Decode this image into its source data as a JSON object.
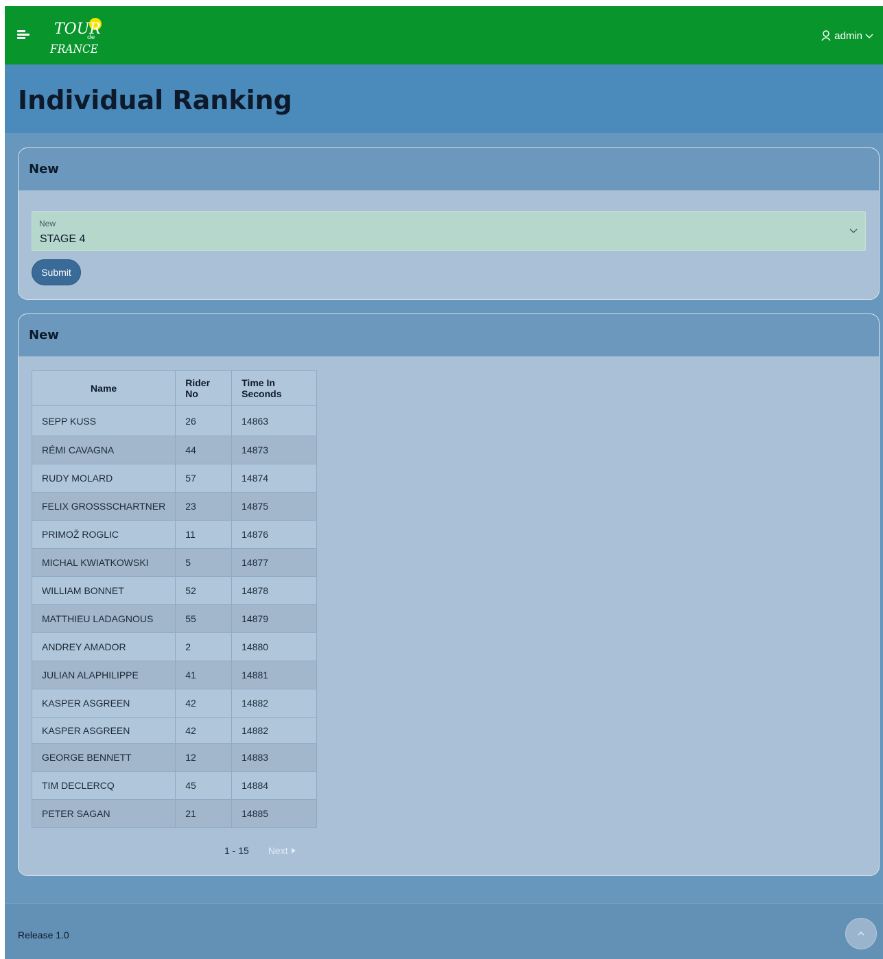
{
  "header": {
    "logo_text_1": "TOUR",
    "logo_text_2": "de",
    "logo_text_3": "FRANCE",
    "user_label": "admin"
  },
  "page": {
    "title": "Individual Ranking"
  },
  "selection_card": {
    "title": "New",
    "select_label": "New",
    "select_value": "STAGE 4",
    "submit_label": "Submit"
  },
  "ranking_card": {
    "title": "New",
    "columns": [
      "Name",
      "Rider No",
      "Time In Seconds"
    ],
    "rows": [
      {
        "name": "SEPP KUSS",
        "rider_no": "26",
        "time": "14863"
      },
      {
        "name": "RÉMI CAVAGNA",
        "rider_no": "44",
        "time": "14873"
      },
      {
        "name": "RUDY MOLARD",
        "rider_no": "57",
        "time": "14874"
      },
      {
        "name": "FELIX GROSSSCHARTNER",
        "rider_no": "23",
        "time": "14875"
      },
      {
        "name": "PRIMOŽ ROGLIC",
        "rider_no": "11",
        "time": "14876"
      },
      {
        "name": "MICHAL KWIATKOWSKI",
        "rider_no": "5",
        "time": "14877"
      },
      {
        "name": "WILLIAM BONNET",
        "rider_no": "52",
        "time": "14878"
      },
      {
        "name": "MATTHIEU LADAGNOUS",
        "rider_no": "55",
        "time": "14879"
      },
      {
        "name": "ANDREY AMADOR",
        "rider_no": "2",
        "time": "14880"
      },
      {
        "name": "JULIAN ALAPHILIPPE",
        "rider_no": "41",
        "time": "14881"
      },
      {
        "name": "KASPER ASGREEN",
        "rider_no": "42",
        "time": "14882"
      },
      {
        "name": "KASPER ASGREEN",
        "rider_no": "42",
        "time": "14882"
      },
      {
        "name": "GEORGE BENNETT",
        "rider_no": "12",
        "time": "14883"
      },
      {
        "name": "TIM DECLERCQ",
        "rider_no": "45",
        "time": "14884"
      },
      {
        "name": "PETER SAGAN",
        "rider_no": "21",
        "time": "14885"
      }
    ],
    "pagination": {
      "range": "1 - 15",
      "next_label": "Next"
    }
  },
  "footer": {
    "release": "Release 1.0"
  },
  "colors": {
    "topbar": "#08952b",
    "page_header": "#4a8bbc",
    "background": "#6897bd",
    "card": "#a9c0d6",
    "select": "#b6d7cb",
    "button": "#3a6a97",
    "logo_yellow": "#f5e100"
  },
  "icons": {
    "menu": "hamburger-icon",
    "user": "user-icon",
    "user_chevron": "chevron-down-icon",
    "select_chevron": "chevron-down-icon",
    "next": "triangle-right-icon",
    "scroll_top": "chevron-up-icon"
  }
}
